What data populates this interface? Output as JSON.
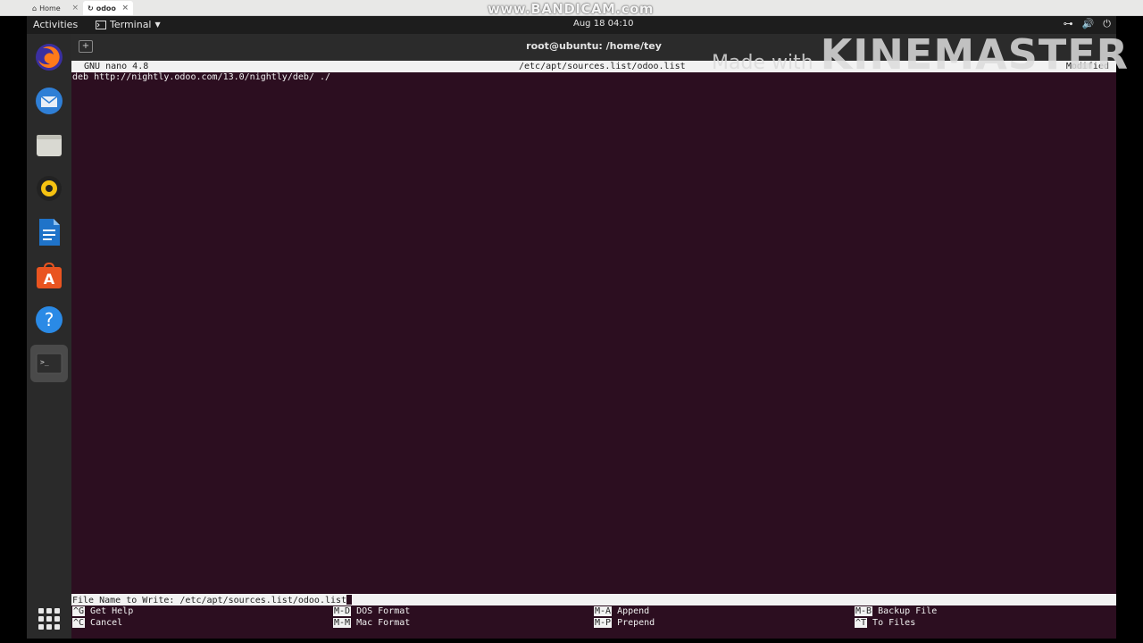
{
  "host_browser": {
    "tabs": [
      {
        "label": "Home"
      },
      {
        "label": "odoo"
      }
    ]
  },
  "recorder_watermark": "www.BANDICAM.com",
  "topbar": {
    "activities": "Activities",
    "app_menu": "Terminal",
    "clock": "Aug 18  04:10"
  },
  "dock": {
    "items": [
      {
        "icon": "firefox-icon"
      },
      {
        "icon": "thunderbird-icon"
      },
      {
        "icon": "files-icon"
      },
      {
        "icon": "rhythmbox-icon"
      },
      {
        "icon": "libreoffice-writer-icon"
      },
      {
        "icon": "software-center-icon"
      },
      {
        "icon": "help-icon"
      },
      {
        "icon": "terminal-icon",
        "active": true
      }
    ]
  },
  "window": {
    "title": "root@ubuntu: /home/tey"
  },
  "nano": {
    "version": "GNU nano 4.8",
    "filename": "/etc/apt/sources.list/odoo.list",
    "status": "Modified",
    "content_line": "deb http://nightly.odoo.com/13.0/nightly/deb/ ./",
    "prompt": "File Name to Write: /etc/apt/sources.list/odoo.list",
    "shortcuts": [
      {
        "key": "^G",
        "label": "Get Help"
      },
      {
        "key": "^C",
        "label": "Cancel"
      },
      {
        "key": "M-D",
        "label": "DOS Format"
      },
      {
        "key": "M-M",
        "label": "Mac Format"
      },
      {
        "key": "M-A",
        "label": "Append"
      },
      {
        "key": "M-P",
        "label": "Prepend"
      },
      {
        "key": "M-B",
        "label": "Backup File"
      },
      {
        "key": "^T",
        "label": "To Files"
      }
    ]
  },
  "editor_watermark": {
    "made_with": "Made with",
    "brand": "KINEMASTER"
  }
}
